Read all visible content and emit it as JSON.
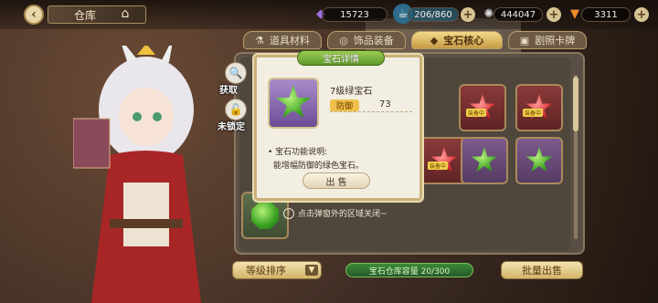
{
  "header": {
    "title": "仓库",
    "resources": [
      {
        "name": "crystal",
        "value": "15723",
        "icon": "purple-crystal-icon"
      },
      {
        "name": "stamina",
        "value": "206/860",
        "icon": "stamina-icon"
      },
      {
        "name": "coin",
        "value": "444047",
        "icon": "coin-icon"
      },
      {
        "name": "carrot",
        "value": "3311",
        "icon": "carrot-icon"
      }
    ]
  },
  "tabs": [
    {
      "label": "道具材料",
      "active": false
    },
    {
      "label": "饰品装备",
      "active": false
    },
    {
      "label": "宝石核心",
      "active": true
    },
    {
      "label": "剧照卡牌",
      "active": false
    }
  ],
  "side_buttons": {
    "obtain": "获取",
    "unlock": "未锁定"
  },
  "grid": {
    "equip_tag": "装备中"
  },
  "popup": {
    "title": "宝石详情",
    "gem_name": "7级绿宝石",
    "stat_label": "防御",
    "stat_value": "73",
    "desc_head": "• 宝石功能说明:",
    "desc_text": "能增幅防御的绿色宝石。",
    "sell_label": "出 售"
  },
  "hint": "点击弹窗外的区域关闭~",
  "bottom": {
    "sort_label": "等级排序",
    "capacity": "宝石仓库容量 20/300",
    "batch_sell": "批量出售"
  },
  "colors": {
    "accent": "#c69a45",
    "popup_title": "#5f9a2a",
    "capacity_bar": "#3d8a3a"
  }
}
